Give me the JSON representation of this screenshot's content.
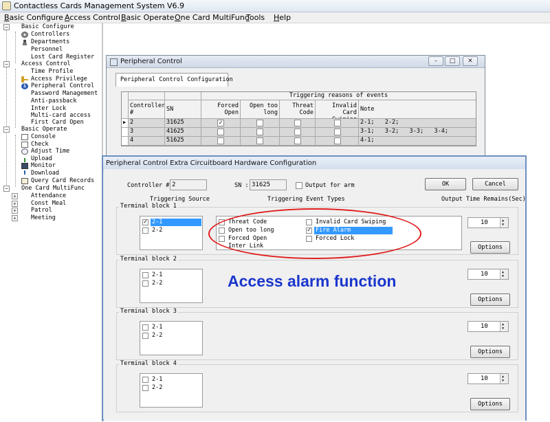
{
  "app": {
    "title": "Contactless Cards Management System  V6.9",
    "menu": [
      "Basic Configure",
      "Access Control",
      "Basic Operate",
      "One Card MultiFunc",
      "Tools",
      "Help"
    ]
  },
  "tree": {
    "basic_configure": {
      "label": "Basic Configure",
      "items": [
        "Controllers",
        "Departments",
        "Personnel",
        "Lost Card Register"
      ]
    },
    "access_control": {
      "label": "Access Control",
      "items": [
        "Time Profile",
        "Access Privilege",
        "Peripheral Control",
        "Password Management",
        "Anti-passback",
        "Inter Lock",
        "Multi-card access",
        "First Card Open"
      ]
    },
    "basic_operate": {
      "label": "Basic Operate",
      "items": [
        "Console",
        "Check",
        "Adjust Time",
        "Upload",
        "Monitor",
        "Download",
        "Query Card Records"
      ]
    },
    "one_card": {
      "label": "One Card MultiFunc",
      "items": [
        "Attendance",
        "Const Meal",
        "Patrol",
        "Meeting"
      ]
    }
  },
  "peripheral": {
    "title": "Peripheral Control",
    "tab": "Peripheral Control Configuration",
    "group_header": "Triggering reasons of events",
    "headers": {
      "controller": "Controller #",
      "sn": "SN",
      "forced_open": "Forced Open",
      "open_too_long": "Open too long",
      "threat_code": "Threat Code",
      "invalid_card": "Invalid Card Swiping",
      "note": "Note"
    },
    "rows": [
      {
        "controller": "2",
        "sn": "31625",
        "forced_open": true,
        "open_too_long": false,
        "threat_code": false,
        "invalid_card": false,
        "note": "2-1;   2-2;"
      },
      {
        "controller": "3",
        "sn": "41625",
        "forced_open": false,
        "open_too_long": false,
        "threat_code": false,
        "invalid_card": false,
        "note": "3-1;   3-2;   3-3;   3-4;"
      },
      {
        "controller": "4",
        "sn": "51625",
        "forced_open": false,
        "open_too_long": false,
        "threat_code": false,
        "invalid_card": false,
        "note": "4-1;"
      }
    ]
  },
  "extra": {
    "title": "Peripheral Control Extra Circuitboard Hardware Configuration",
    "controller_label": "Controller #:",
    "controller_value": "2",
    "sn_label": "SN :",
    "sn_value": "31625",
    "output_for_arm": "Output for arm",
    "ok": "OK",
    "cancel": "Cancel",
    "col_source": "Triggering Source",
    "col_event": "Triggering Event Types",
    "col_output": "Output Time Remains(Sec)",
    "events_left": [
      "Threat Code",
      "Open too long",
      "Forced Open",
      "Inter Link"
    ],
    "events_right": [
      "Invalid Card Swiping",
      "Fire Alarm",
      "Forced Lock"
    ],
    "options_label": "Options",
    "blocks": [
      {
        "title": "Terminal block 1",
        "sources": [
          "2-1",
          "2-2"
        ],
        "output": "10"
      },
      {
        "title": "Terminal block 2",
        "sources": [
          "2-1",
          "2-2"
        ],
        "output": "10"
      },
      {
        "title": "Terminal block 3",
        "sources": [
          "2-1",
          "2-2"
        ],
        "output": "10"
      },
      {
        "title": "Terminal block 4",
        "sources": [
          "2-1",
          "2-2"
        ],
        "output": "10"
      }
    ]
  },
  "annotation": "Access alarm function",
  "colors": {
    "annotation_text": "#1b36cc",
    "annotation_ellipse": "#e01b1b",
    "selection": "#3399ff"
  }
}
